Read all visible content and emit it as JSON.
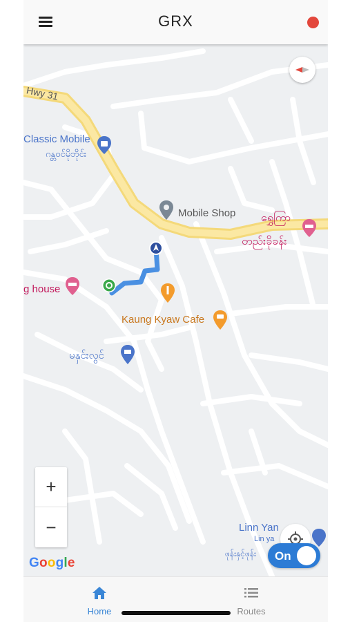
{
  "app": {
    "title": "GRX",
    "status_color": "#e3473c"
  },
  "map": {
    "labels": {
      "highway": "Hwy 31",
      "classic_mobile": "Classic Mobile",
      "classic_mobile_local": "ဂန္တဝင်မိုဘိုင်း",
      "mobile_shop": "Mobile Shop",
      "guest_house_local_1": "ရွှေကြာ",
      "guest_house_local_2": "တည်းခိုခန်း",
      "house": "g house",
      "kaung_kyaw_cafe": "Kaung Kyaw Cafe",
      "market_local": "မနှင်းလွင်",
      "linn_yan": "Linn Yan",
      "linn_ya": "Lin ya",
      "bottom_local": "ဖုန်းနှင့်ဖုန်း"
    },
    "route_color": "#4a90e2",
    "attribution": "Google"
  },
  "controls": {
    "zoom_in": "+",
    "zoom_out": "−",
    "toggle_label": "On",
    "toggle_on": true
  },
  "nav": {
    "items": [
      {
        "label": "Home",
        "icon": "home-icon",
        "active": true
      },
      {
        "label": "Routes",
        "icon": "list-icon",
        "active": false
      }
    ],
    "active_color": "#3a86d6",
    "inactive_color": "#8a8a8a"
  }
}
